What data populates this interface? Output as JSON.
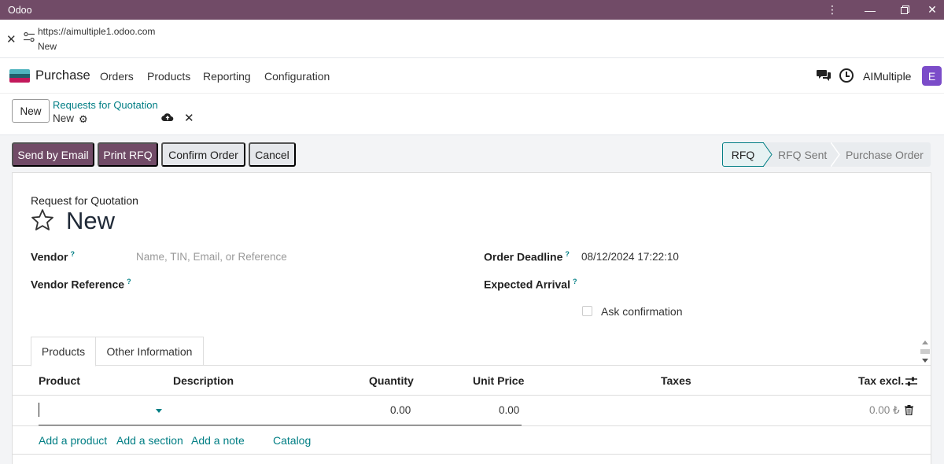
{
  "window": {
    "title": "Odoo",
    "more_icon": "kebab-icon",
    "minimize_icon": "minimize-icon",
    "restore_icon": "restore-icon",
    "close_icon": "close-icon"
  },
  "urlbar": {
    "url": "https://aimultiple1.odoo.com",
    "page_title": "New"
  },
  "navbar": {
    "app_name": "Purchase",
    "menu": [
      "Orders",
      "Products",
      "Reporting",
      "Configuration"
    ],
    "company": "AIMultiple",
    "avatar_letter": "E",
    "brand_color": "#714b67",
    "accent_color": "#017e84",
    "avatar_color": "#7b4cc9"
  },
  "control_panel": {
    "new_button": "New",
    "breadcrumb": "Requests for Quotation",
    "current": "New"
  },
  "actions": {
    "send_email": "Send by Email",
    "print_rfq": "Print RFQ",
    "confirm": "Confirm Order",
    "cancel": "Cancel"
  },
  "status": {
    "stages": [
      "RFQ",
      "RFQ Sent",
      "Purchase Order"
    ],
    "active": "RFQ"
  },
  "form": {
    "heading_label": "Request for Quotation",
    "record_name": "New",
    "vendor_label": "Vendor",
    "vendor_placeholder": "Name, TIN, Email, or Reference",
    "vendor_ref_label": "Vendor Reference",
    "order_deadline_label": "Order Deadline",
    "order_deadline_value": "08/12/2024 17:22:10",
    "expected_arrival_label": "Expected Arrival",
    "ask_confirmation_label": "Ask confirmation",
    "help_marker": "?"
  },
  "tabs": [
    "Products",
    "Other Information"
  ],
  "lines_table": {
    "columns": [
      "Product",
      "Description",
      "Quantity",
      "Unit Price",
      "Taxes",
      "Tax excl."
    ],
    "row": {
      "product": "",
      "quantity": "0.00",
      "unit_price": "0.00",
      "subtotal": "0.00 ₺"
    },
    "add_links": [
      "Add a product",
      "Add a section",
      "Add a note",
      "Catalog"
    ]
  }
}
